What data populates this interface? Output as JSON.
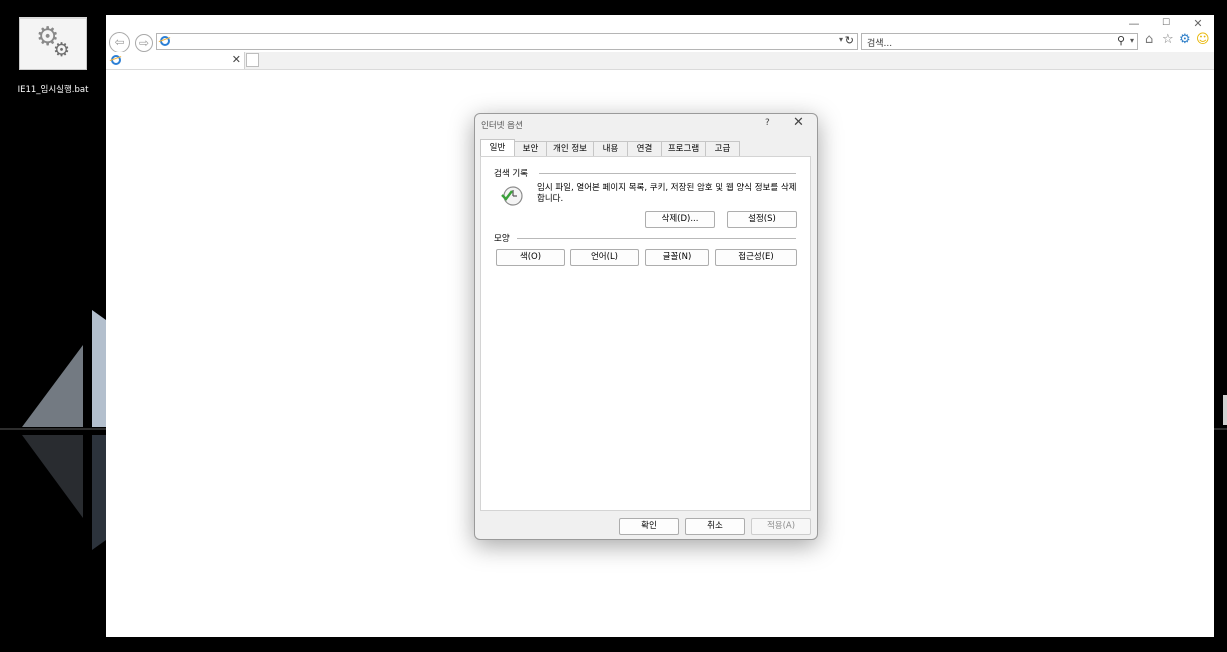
{
  "desktop": {
    "icon_label": "IE11_임시실행.bat"
  },
  "browser": {
    "address_value": "",
    "search_placeholder": "검색...",
    "tab_title": "",
    "window_controls": {
      "minimize": "—",
      "maximize": "☐",
      "close": "✕"
    },
    "icons": [
      "back-icon",
      "forward-icon",
      "refresh-icon",
      "search-icon",
      "home-icon",
      "favorites-star-icon",
      "settings-gear-icon",
      "smiley-feedback-icon"
    ]
  },
  "dialog": {
    "title": "인터넷 옵션",
    "help": "?",
    "close": "✕",
    "tabs": [
      "일반",
      "보안",
      "개인 정보",
      "내용",
      "연결",
      "프로그램",
      "고급"
    ],
    "active_tab": "일반",
    "history": {
      "label": "검색 기록",
      "description": "임시 파일, 열어본 페이지 목록, 쿠키, 저장된 암호 및 웹 양식 정보를 삭제합니다.",
      "delete_button": "삭제(D)...",
      "settings_button": "설정(S)"
    },
    "appearance": {
      "label": "모양",
      "colors_button": "색(O)",
      "languages_button": "언어(L)",
      "fonts_button": "글꼴(N)",
      "accessibility_button": "접근성(E)"
    },
    "footer": {
      "ok_button": "확인",
      "cancel_button": "취소",
      "apply_button": "적용(A)"
    }
  }
}
